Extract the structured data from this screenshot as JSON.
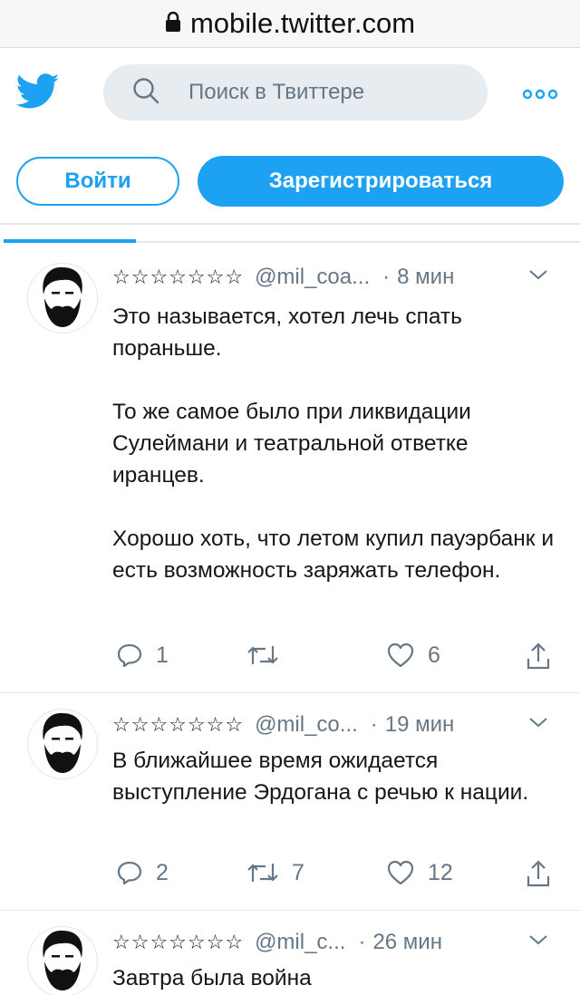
{
  "browser": {
    "url": "mobile.twitter.com"
  },
  "header": {
    "search_placeholder": "Поиск в Твиттере"
  },
  "auth": {
    "login_label": "Войти",
    "signup_label": "Зарегистрироваться"
  },
  "colors": {
    "accent": "#1da1f2",
    "secondary_text": "#657786",
    "search_bg": "#e6ecf0"
  },
  "icons": [
    "lock-icon",
    "twitter-bird-icon",
    "search-icon",
    "more-icon",
    "caret-down-icon",
    "reply-icon",
    "retweet-icon",
    "like-icon",
    "share-icon"
  ],
  "tweets": [
    {
      "name": "☆☆☆☆☆☆☆",
      "handle": "@mil_coa...",
      "time": "8 мин",
      "text": "Это называется, хотел лечь спать пораньше.\n\nТо же самое было при ликвидации Сулеймани и театральной ответке иранцев.\n\nХорошо хоть, что летом купил пауэрбанк и есть возможность заряжать телефон.",
      "replies": "1",
      "retweets": "",
      "likes": "6"
    },
    {
      "name": "☆☆☆☆☆☆☆",
      "handle": "@mil_co...",
      "time": "19 мин",
      "text": "В ближайшее время ожидается выступление Эрдогана с речью к нации.",
      "replies": "2",
      "retweets": "7",
      "likes": "12"
    },
    {
      "name": "☆☆☆☆☆☆☆",
      "handle": "@mil_c...",
      "time": "26 мин",
      "text": "Завтра была война"
    }
  ]
}
